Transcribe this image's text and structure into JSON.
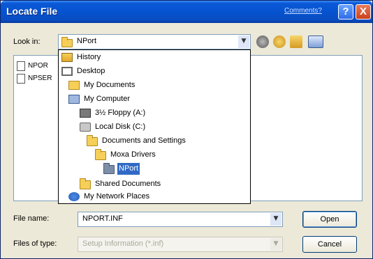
{
  "window": {
    "title": "Locate File",
    "comments_link": "Comments?",
    "help_glyph": "?",
    "close_glyph": "X"
  },
  "look_in": {
    "label": "Look in:",
    "value": "NPort",
    "arrow": "▼"
  },
  "file_list": {
    "items": [
      "NPOR",
      "NPSER"
    ]
  },
  "dropdown": {
    "items": [
      {
        "label": "History",
        "icon": "history-icon",
        "indent": 0
      },
      {
        "label": "Desktop",
        "icon": "desktop-icon",
        "indent": 0
      },
      {
        "label": "My Documents",
        "icon": "documents-icon",
        "indent": 1
      },
      {
        "label": "My Computer",
        "icon": "computer-icon",
        "indent": 1
      },
      {
        "label": "3½ Floppy (A:)",
        "icon": "floppy-icon",
        "indent": 2
      },
      {
        "label": "Local Disk (C:)",
        "icon": "disk-icon",
        "indent": 2
      },
      {
        "label": "Documents and Settings",
        "icon": "folder-icon",
        "indent": 3
      },
      {
        "label": "Moxa Drivers",
        "icon": "folder-icon",
        "indent": 4
      },
      {
        "label": "NPort",
        "icon": "folder-icon",
        "indent": 5,
        "selected": true
      },
      {
        "label": "Shared Documents",
        "icon": "folder-icon",
        "indent": 2
      },
      {
        "label": "My Network Places",
        "icon": "network-icon",
        "indent": 1
      }
    ]
  },
  "file_name": {
    "label": "File name:",
    "value": "NPORT.INF",
    "arrow": "▼"
  },
  "files_of_type": {
    "label": "Files of type:",
    "value": "Setup Information (*.inf)",
    "arrow": "▼"
  },
  "buttons": {
    "open": "Open",
    "cancel": "Cancel"
  },
  "colors": {
    "title_bar": "#0553d0",
    "selection": "#316ac5",
    "dialog_bg": "#ece9d8"
  }
}
